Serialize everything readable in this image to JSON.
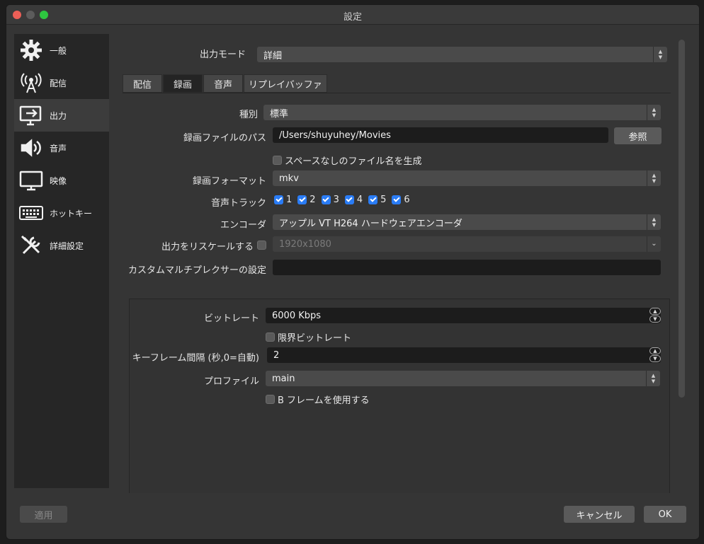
{
  "window": {
    "title": "設定"
  },
  "sidebar": {
    "items": [
      {
        "label": "一般",
        "icon": "gear-icon"
      },
      {
        "label": "配信",
        "icon": "broadcast-antenna-icon"
      },
      {
        "label": "出力",
        "icon": "output-monitor-icon",
        "active": true
      },
      {
        "label": "音声",
        "icon": "speaker-icon"
      },
      {
        "label": "映像",
        "icon": "monitor-icon"
      },
      {
        "label": "ホットキー",
        "icon": "keyboard-icon"
      },
      {
        "label": "詳細設定",
        "icon": "tools-icon"
      }
    ]
  },
  "output_mode": {
    "label": "出力モード",
    "value": "詳細"
  },
  "tabs": [
    {
      "label": "配信"
    },
    {
      "label": "録画",
      "active": true
    },
    {
      "label": "音声"
    },
    {
      "label": "リプレイバッファ"
    }
  ],
  "recording": {
    "type_label": "種別",
    "type_value": "標準",
    "path_label": "録画ファイルのパス",
    "path_value": "/Users/shuyuhey/Movies",
    "browse_label": "参照",
    "nospace_label": "スペースなしのファイル名を生成",
    "format_label": "録画フォーマット",
    "format_value": "mkv",
    "tracks_label": "音声トラック",
    "tracks": [
      "1",
      "2",
      "3",
      "4",
      "5",
      "6"
    ],
    "encoder_label": "エンコーダ",
    "encoder_value": "アップル VT H264 ハードウェアエンコーダ",
    "rescale_label": "出力をリスケールする",
    "rescale_value": "1920x1080",
    "muxer_label": "カスタムマルチプレクサーの設定",
    "muxer_value": ""
  },
  "encoder_settings": {
    "bitrate_label": "ビットレート",
    "bitrate_value": "6000 Kbps",
    "limit_bitrate_label": "限界ビットレート",
    "keyframe_label": "キーフレーム間隔 (秒,0=自動)",
    "keyframe_value": "2",
    "profile_label": "プロファイル",
    "profile_value": "main",
    "bframes_label": "B フレームを使用する"
  },
  "footer": {
    "apply_label": "適用",
    "cancel_label": "キャンセル",
    "ok_label": "OK"
  },
  "colors": {
    "accent": "#2a7cf5",
    "background": "#353535",
    "sidebar": "#262626"
  }
}
